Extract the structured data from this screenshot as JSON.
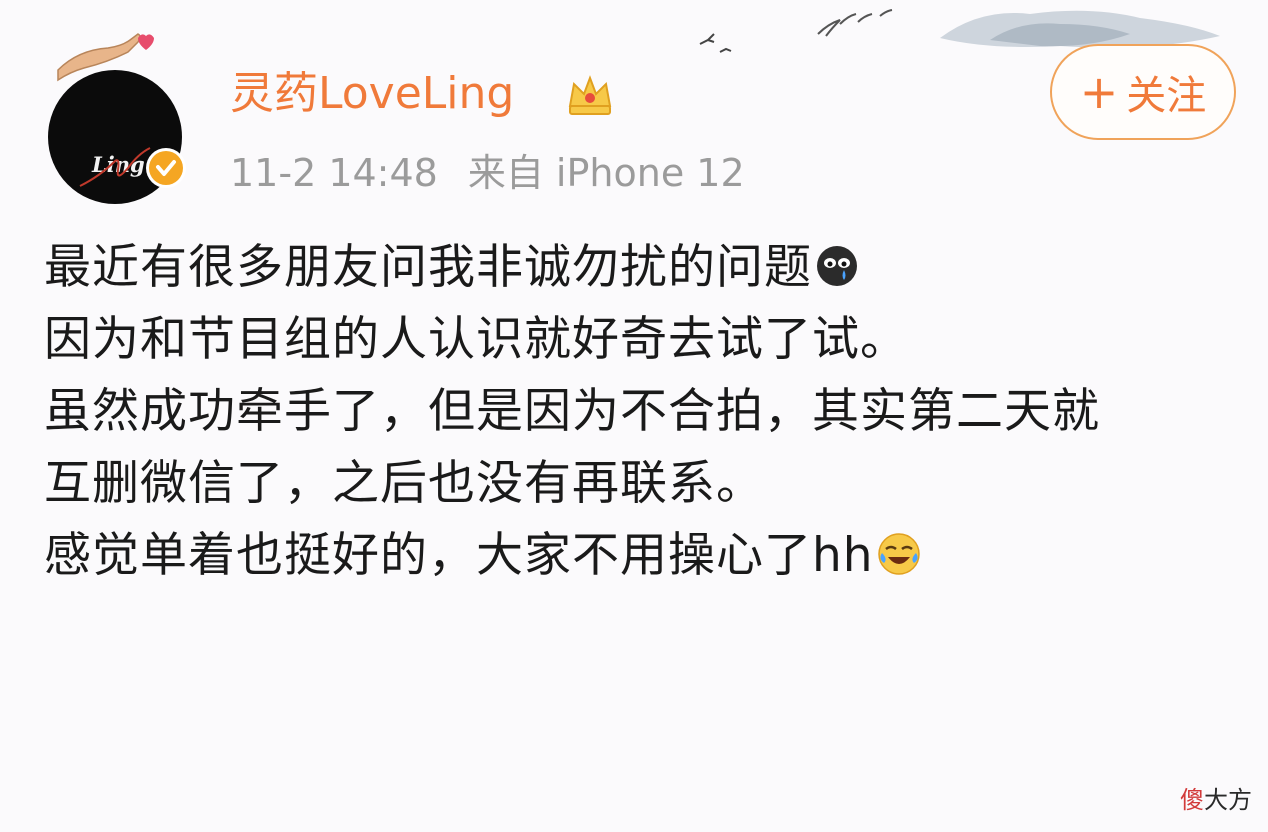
{
  "post": {
    "username": "灵药LoveLing",
    "timestamp": "11-2 14:48",
    "source": "来自 iPhone 12",
    "follow_plus": "+",
    "follow_label": "关注",
    "avatar_text": "Ling",
    "lines": [
      "最近有很多朋友问我非诚勿扰的问题",
      "因为和节目组的人认识就好奇去试了试。",
      "虽然成功牵手了，但是因为不合拍，其实第二天就",
      "互删微信了，之后也没有再联系。",
      "感觉单着也挺好的，大家不用操心了hh"
    ],
    "icons": [
      "hand-heart-icon",
      "verified-badge-icon",
      "crown-icon",
      "crying-emoji-icon",
      "laughing-tears-emoji-icon"
    ]
  },
  "watermark": {
    "first_char": "傻",
    "rest": "大方"
  },
  "colors": {
    "accent": "#f07a3a",
    "meta": "#9b9b9b",
    "text": "#1a1a1a",
    "verified": "#f5a623"
  }
}
